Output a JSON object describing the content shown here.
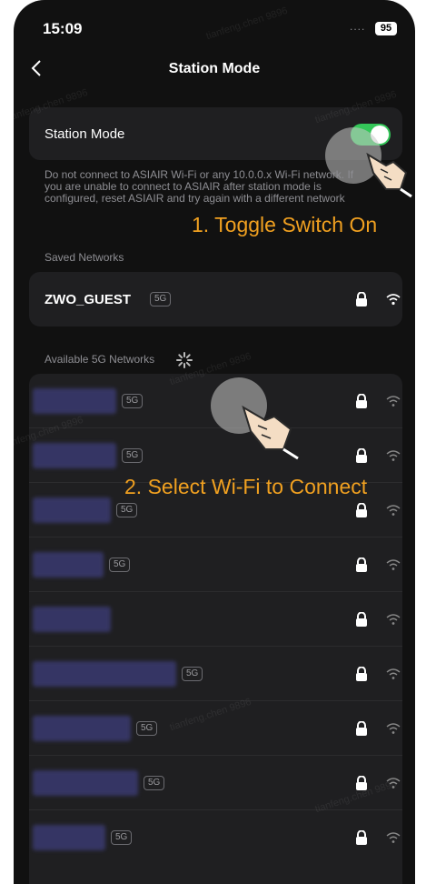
{
  "status_bar": {
    "time": "15:09",
    "signal": "....",
    "battery": "95"
  },
  "nav": {
    "title": "Station Mode",
    "back_icon": "chevron-left-icon"
  },
  "station_toggle": {
    "label": "Station Mode",
    "on": true,
    "accent": "#34c759"
  },
  "info_text": "Do not connect to ASIAIR Wi-Fi or any 10.0.0.x Wi-Fi network. If you are unable to connect to ASIAIR after station mode is configured, reset ASIAIR and try again with a different network",
  "saved_section": {
    "header": "Saved Networks",
    "networks": [
      {
        "name": "ZWO_GUEST",
        "badge": "5G"
      }
    ]
  },
  "available_section": {
    "header": "Available 5G Networks",
    "networks": [
      {
        "badge": "5G"
      },
      {
        "badge": "5G"
      },
      {
        "badge": "5G"
      },
      {
        "badge": "5G"
      },
      {
        "badge": ""
      },
      {
        "badge": "5G"
      },
      {
        "badge": "5G"
      },
      {
        "badge": "5G"
      },
      {
        "badge": "5G"
      }
    ]
  },
  "annotations": {
    "step1": "1. Toggle Switch On",
    "step2": "2. Select Wi-Fi to Connect",
    "color": "#f0a020"
  },
  "watermark": "tianfeng.chen 9896"
}
